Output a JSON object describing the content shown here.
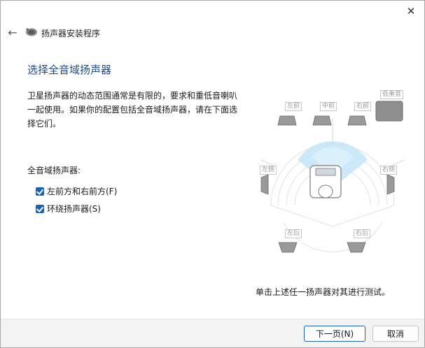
{
  "window": {
    "close_icon": "close-icon",
    "back_icon": "back-arrow-icon"
  },
  "header": {
    "title": "扬声器安装程序",
    "icon": "speaker-setup-icon"
  },
  "main": {
    "heading": "选择全音域扬声器",
    "description": "卫星扬声器的动态范围通常是有限的，要求和重低音喇叭一起使用。如果你的配置包括全音域扬声器，请在下面选择它们。",
    "group_label": "全音域扬声器:",
    "checkboxes": [
      {
        "label": "左前方和右前方(F)",
        "checked": true
      },
      {
        "label": "环绕扬声器(S)",
        "checked": true
      }
    ]
  },
  "diagram": {
    "speakers": {
      "front_left": "左前",
      "front_center": "中前",
      "front_right": "右前",
      "subwoofer": "低重音",
      "side_left": "左侧",
      "side_right": "右侧",
      "rear_left": "左后",
      "rear_right": "右后"
    },
    "accent_color": "#bfe3f7"
  },
  "hint": "单击上述任一扬声器对其进行测试。",
  "footer": {
    "next_label": "下一页(N)",
    "cancel_label": "取消"
  }
}
